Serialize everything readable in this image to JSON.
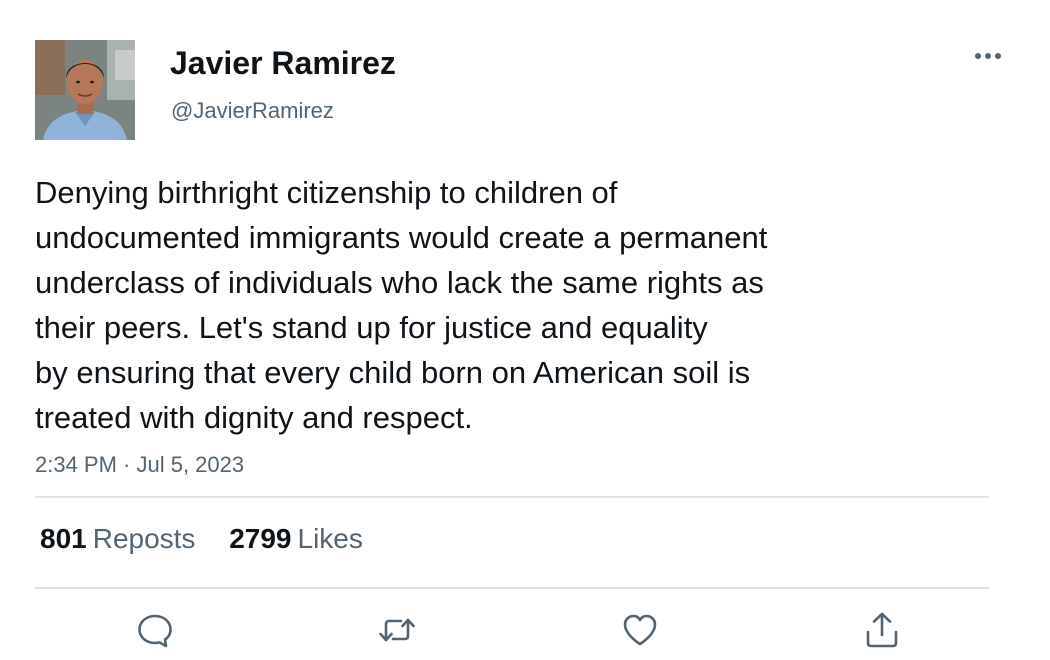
{
  "author": {
    "display_name": "Javier Ramirez",
    "handle": "@JavierRamirez",
    "avatar_icon": "profile-photo"
  },
  "tweet": {
    "text_lines": [
      "Denying birthright citizenship to children of",
      "undocumented immigrants would create a permanent",
      "underclass of individuals who lack the same rights as",
      "their peers. Let's stand up for justice and equality",
      "by ensuring that every child born on American soil is",
      "treated with dignity and respect."
    ],
    "timestamp": "2:34 PM · Jul 5, 2023"
  },
  "stats": {
    "reposts_count": "801",
    "reposts_label": "Reposts",
    "likes_count": "2799",
    "likes_label": "Likes"
  },
  "actions": [
    {
      "name": "reply",
      "icon": "speech-bubble-icon"
    },
    {
      "name": "repost",
      "icon": "repost-arrows-icon"
    },
    {
      "name": "like",
      "icon": "heart-icon"
    },
    {
      "name": "share",
      "icon": "share-upload-icon"
    }
  ],
  "colors": {
    "text_primary": "#0f1419",
    "text_secondary": "#536471",
    "divider": "#dfe3e7",
    "background": "#ffffff"
  }
}
